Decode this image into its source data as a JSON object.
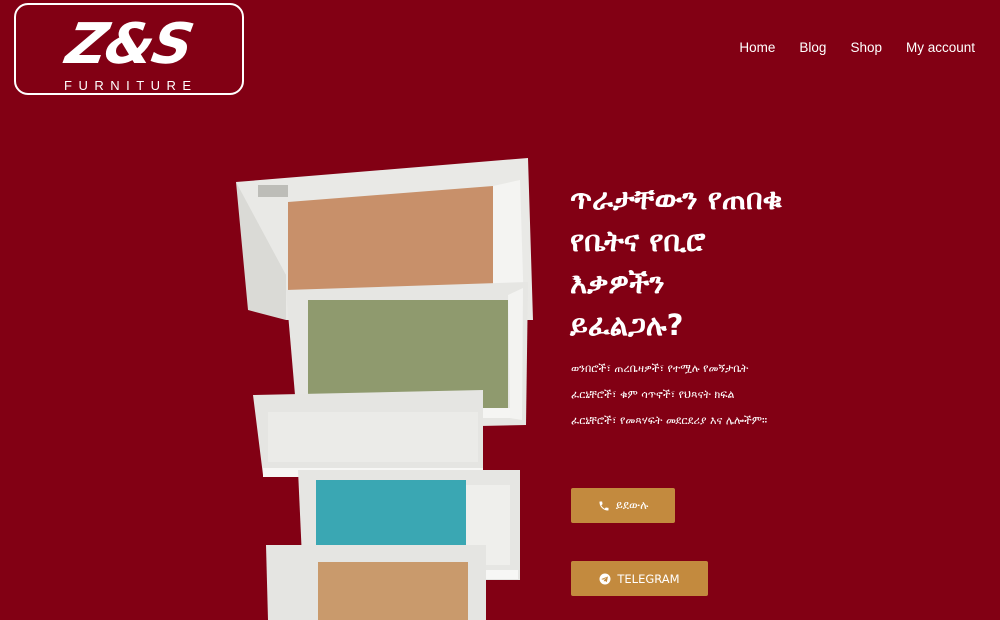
{
  "logo": {
    "main": "Z&S",
    "sub": "FURNITURE"
  },
  "nav": {
    "items": [
      "Home",
      "Blog",
      "Shop",
      "My account"
    ]
  },
  "hero": {
    "headline": "ጥራታቸውን የጠበቁ\nየቤትና የቢሮ\nእቃዎችን\nይፈልጋሉ?",
    "description": "ወንበሮች፣ ጠረቤዛዎች፣ የተሟሉ የመኝታቤት\nፈርኒቸሮች፣ ቁም ሳጥኖች፣ የህጻናት ክፍል\nፈርኒቸሮች፣ የመጻሃፍት መደርደሪያ እና ሌሎችም።"
  },
  "buttons": {
    "call_label": "ይደውሉ",
    "telegram_label": "TELEGRAM"
  },
  "colors": {
    "background": "#820014",
    "button": "#c38a3e"
  },
  "icons": {
    "call": "phone-icon",
    "telegram": "telegram-icon"
  }
}
